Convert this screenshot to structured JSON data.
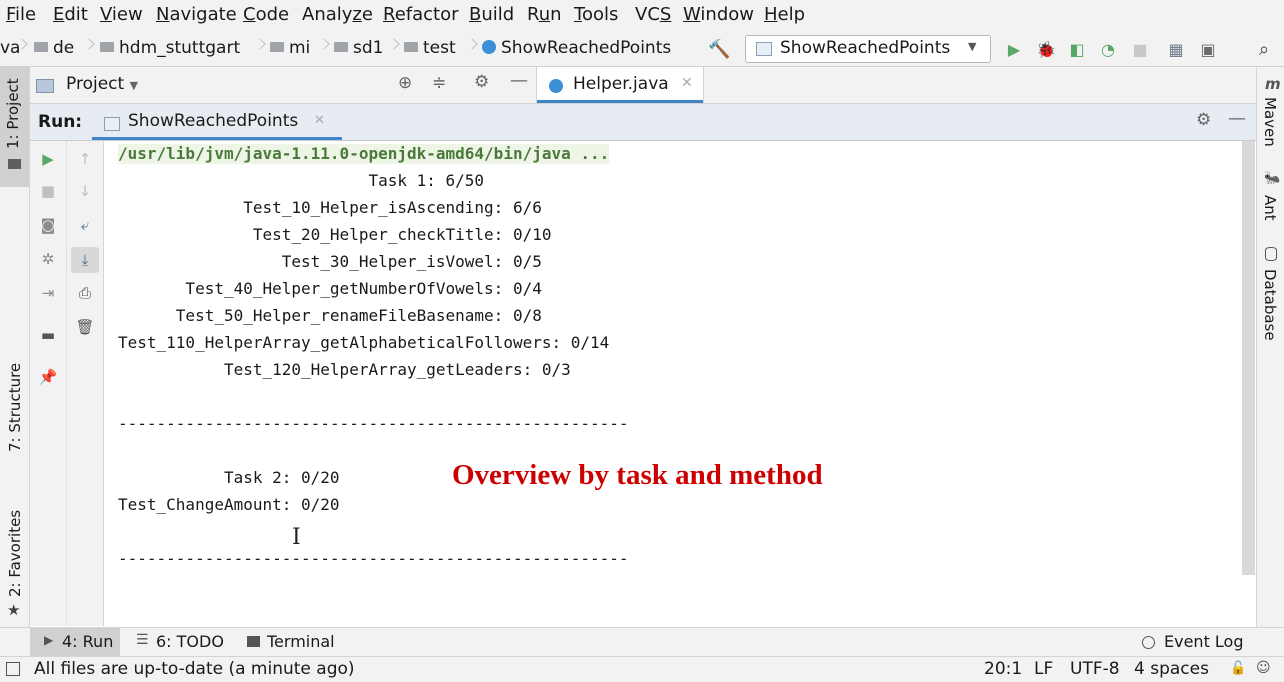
{
  "menu": [
    {
      "pre": "",
      "u": "F",
      "post": "ile"
    },
    {
      "pre": "",
      "u": "E",
      "post": "dit"
    },
    {
      "pre": "",
      "u": "V",
      "post": "iew"
    },
    {
      "pre": "",
      "u": "N",
      "post": "avigate"
    },
    {
      "pre": "",
      "u": "C",
      "post": "ode"
    },
    {
      "pre": "Analy",
      "u": "z",
      "post": "e"
    },
    {
      "pre": "",
      "u": "R",
      "post": "efactor"
    },
    {
      "pre": "",
      "u": "B",
      "post": "uild"
    },
    {
      "pre": "R",
      "u": "u",
      "post": "n"
    },
    {
      "pre": "",
      "u": "T",
      "post": "ools"
    },
    {
      "pre": "VC",
      "u": "S",
      "post": ""
    },
    {
      "pre": "",
      "u": "W",
      "post": "indow"
    },
    {
      "pre": "",
      "u": "H",
      "post": "elp"
    }
  ],
  "breadcrumbs": [
    "va",
    "de",
    "hdm_stuttgart",
    "mi",
    "sd1",
    "test",
    "ShowReachedPoints"
  ],
  "run_config": "ShowReachedPoints",
  "left_tools": {
    "project": "1: Project",
    "structure": "7: Structure",
    "favorites": "2: Favorites"
  },
  "right_tools": {
    "maven": "Maven",
    "ant": "Ant",
    "database": "Database"
  },
  "project_panel": {
    "title": "Project",
    "editor_tab": "Helper.java"
  },
  "run_panel": {
    "label": "Run:",
    "tab": "ShowReachedPoints"
  },
  "console": {
    "cmd": "/usr/lib/jvm/java-1.11.0-openjdk-amd64/bin/java ...",
    "lines": [
      "                          Task 1: 6/50",
      "             Test_10_Helper_isAscending: 6/6",
      "              Test_20_Helper_checkTitle: 0/10",
      "                 Test_30_Helper_isVowel: 0/5",
      "       Test_40_Helper_getNumberOfVowels: 0/4",
      "      Test_50_Helper_renameFileBasename: 0/8",
      "Test_110_HelperArray_getAlphabeticalFollowers: 0/14",
      "           Test_120_HelperArray_getLeaders: 0/3",
      "",
      "-----------------------------------------------------",
      "",
      "           Task 2: 0/20",
      "Test_ChangeAmount: 0/20",
      "",
      "-----------------------------------------------------"
    ]
  },
  "overlay_text": "Overview by task and method",
  "bottom_tabs": {
    "run": "4: Run",
    "todo": "6: TODO",
    "terminal": "Terminal",
    "event_log": "Event Log"
  },
  "status": {
    "message": "All files are up-to-date (a minute ago)",
    "position": "20:1",
    "line_sep": "LF",
    "encoding": "UTF-8",
    "indent": "4 spaces"
  },
  "colors": {
    "accent": "#cc0000",
    "run_green": "#59a869",
    "tab_underline": "#4083c9"
  }
}
